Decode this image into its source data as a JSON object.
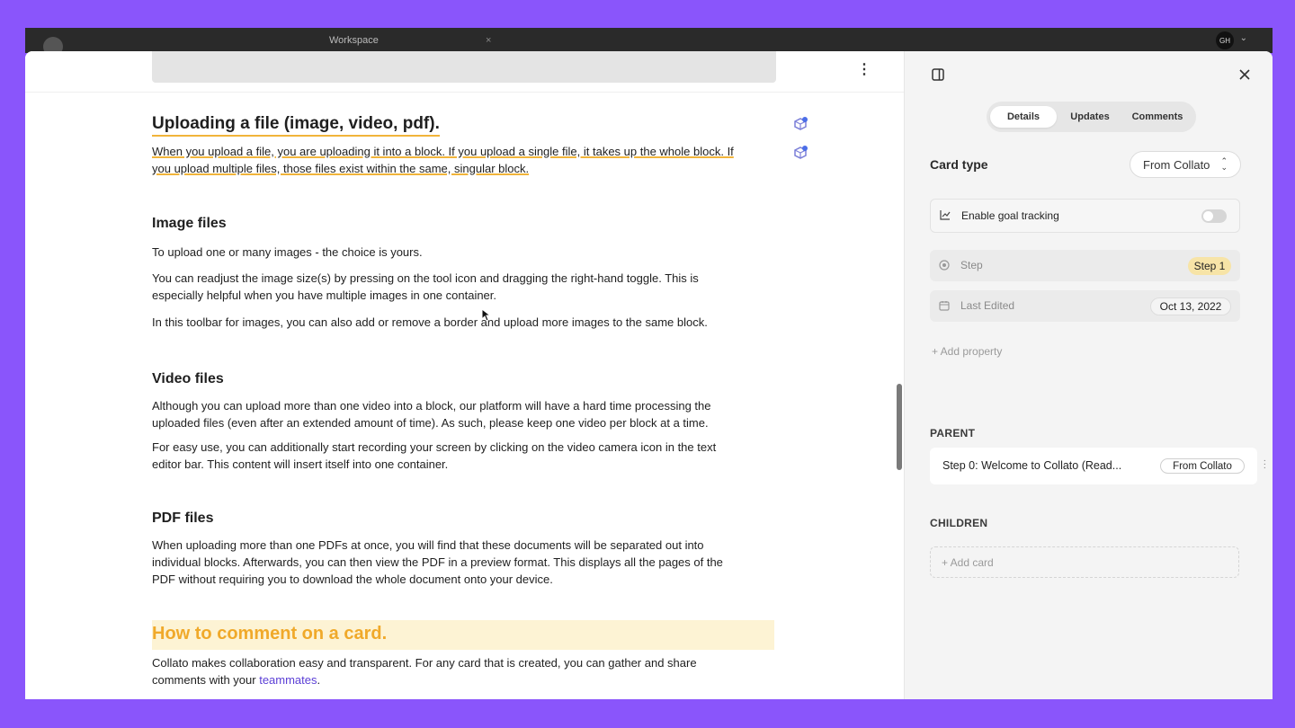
{
  "topbar": {
    "workspace_label": "Workspace",
    "avatar_initials": "GH"
  },
  "doc": {
    "title": "Uploading a file (image, video, pdf).",
    "intro_line1": "When you upload a file, you are uploading it into a block. If you upload a single file, it takes up the whole block. If",
    "intro_line2": "you upload multiple files, those files exist within the same, singular block.",
    "image_heading": "Image files",
    "image_p1": "To upload one or many images - the choice is yours.",
    "image_p2_line1": "You can readjust the image size(s) by pressing on the tool icon and dragging the right-hand toggle. This is",
    "image_p2_line2": "especially helpful when you have multiple images in one container.",
    "image_p3": "In this toolbar for images, you can also add or remove a border and upload more images to the same block.",
    "video_heading": "Video files",
    "video_p1_line1": "Although you can upload more than one video into a block, our platform will have a hard time processing the",
    "video_p1_line2": "uploaded files (even after an extended amount of time). As such, please keep one video per block at a time.",
    "video_p2_line1": "For easy use, you can additionally start recording your screen by clicking on the video camera icon in the text",
    "video_p2_line2": "editor bar. This content will insert itself into one container.",
    "pdf_heading": "PDF files",
    "pdf_p1_line1": "When uploading more than one PDFs at once, you will find that these documents will be separated out into",
    "pdf_p1_line2": "individual blocks. Afterwards, you can then view the PDF in a preview format. This displays all the pages of the",
    "pdf_p1_line3": "PDF without requiring you to download the whole document onto your device.",
    "comment_heading": "How to comment on a card.",
    "comment_p1_line1": "Collato makes collaboration easy and transparent. For any card that is created, you can gather and share",
    "comment_p1_line2_a": "comments with your ",
    "comment_p1_link": "teammates",
    "comment_p1_line2_b": "."
  },
  "panel": {
    "tabs": [
      {
        "label": "Details"
      },
      {
        "label": "Updates"
      },
      {
        "label": "Comments"
      }
    ],
    "card_type_label": "Card type",
    "card_type_value": "From Collato",
    "goal_tracking_label": "Enable goal tracking",
    "goal_tracking_enabled": false,
    "step_label": "Step",
    "step_value": "Step 1",
    "last_edited_label": "Last Edited",
    "last_edited_value": "Oct 13, 2022",
    "add_property_label": "+ Add property",
    "parent_heading": "PARENT",
    "parent_title": "Step 0: Welcome to Collato (Read...",
    "parent_tag": "From Collato",
    "children_heading": "CHILDREN",
    "add_card_label": "+ Add card"
  },
  "colors": {
    "frame": "#8a55fb",
    "accent_yellow": "#f1b43a",
    "link": "#5b3fd6"
  }
}
